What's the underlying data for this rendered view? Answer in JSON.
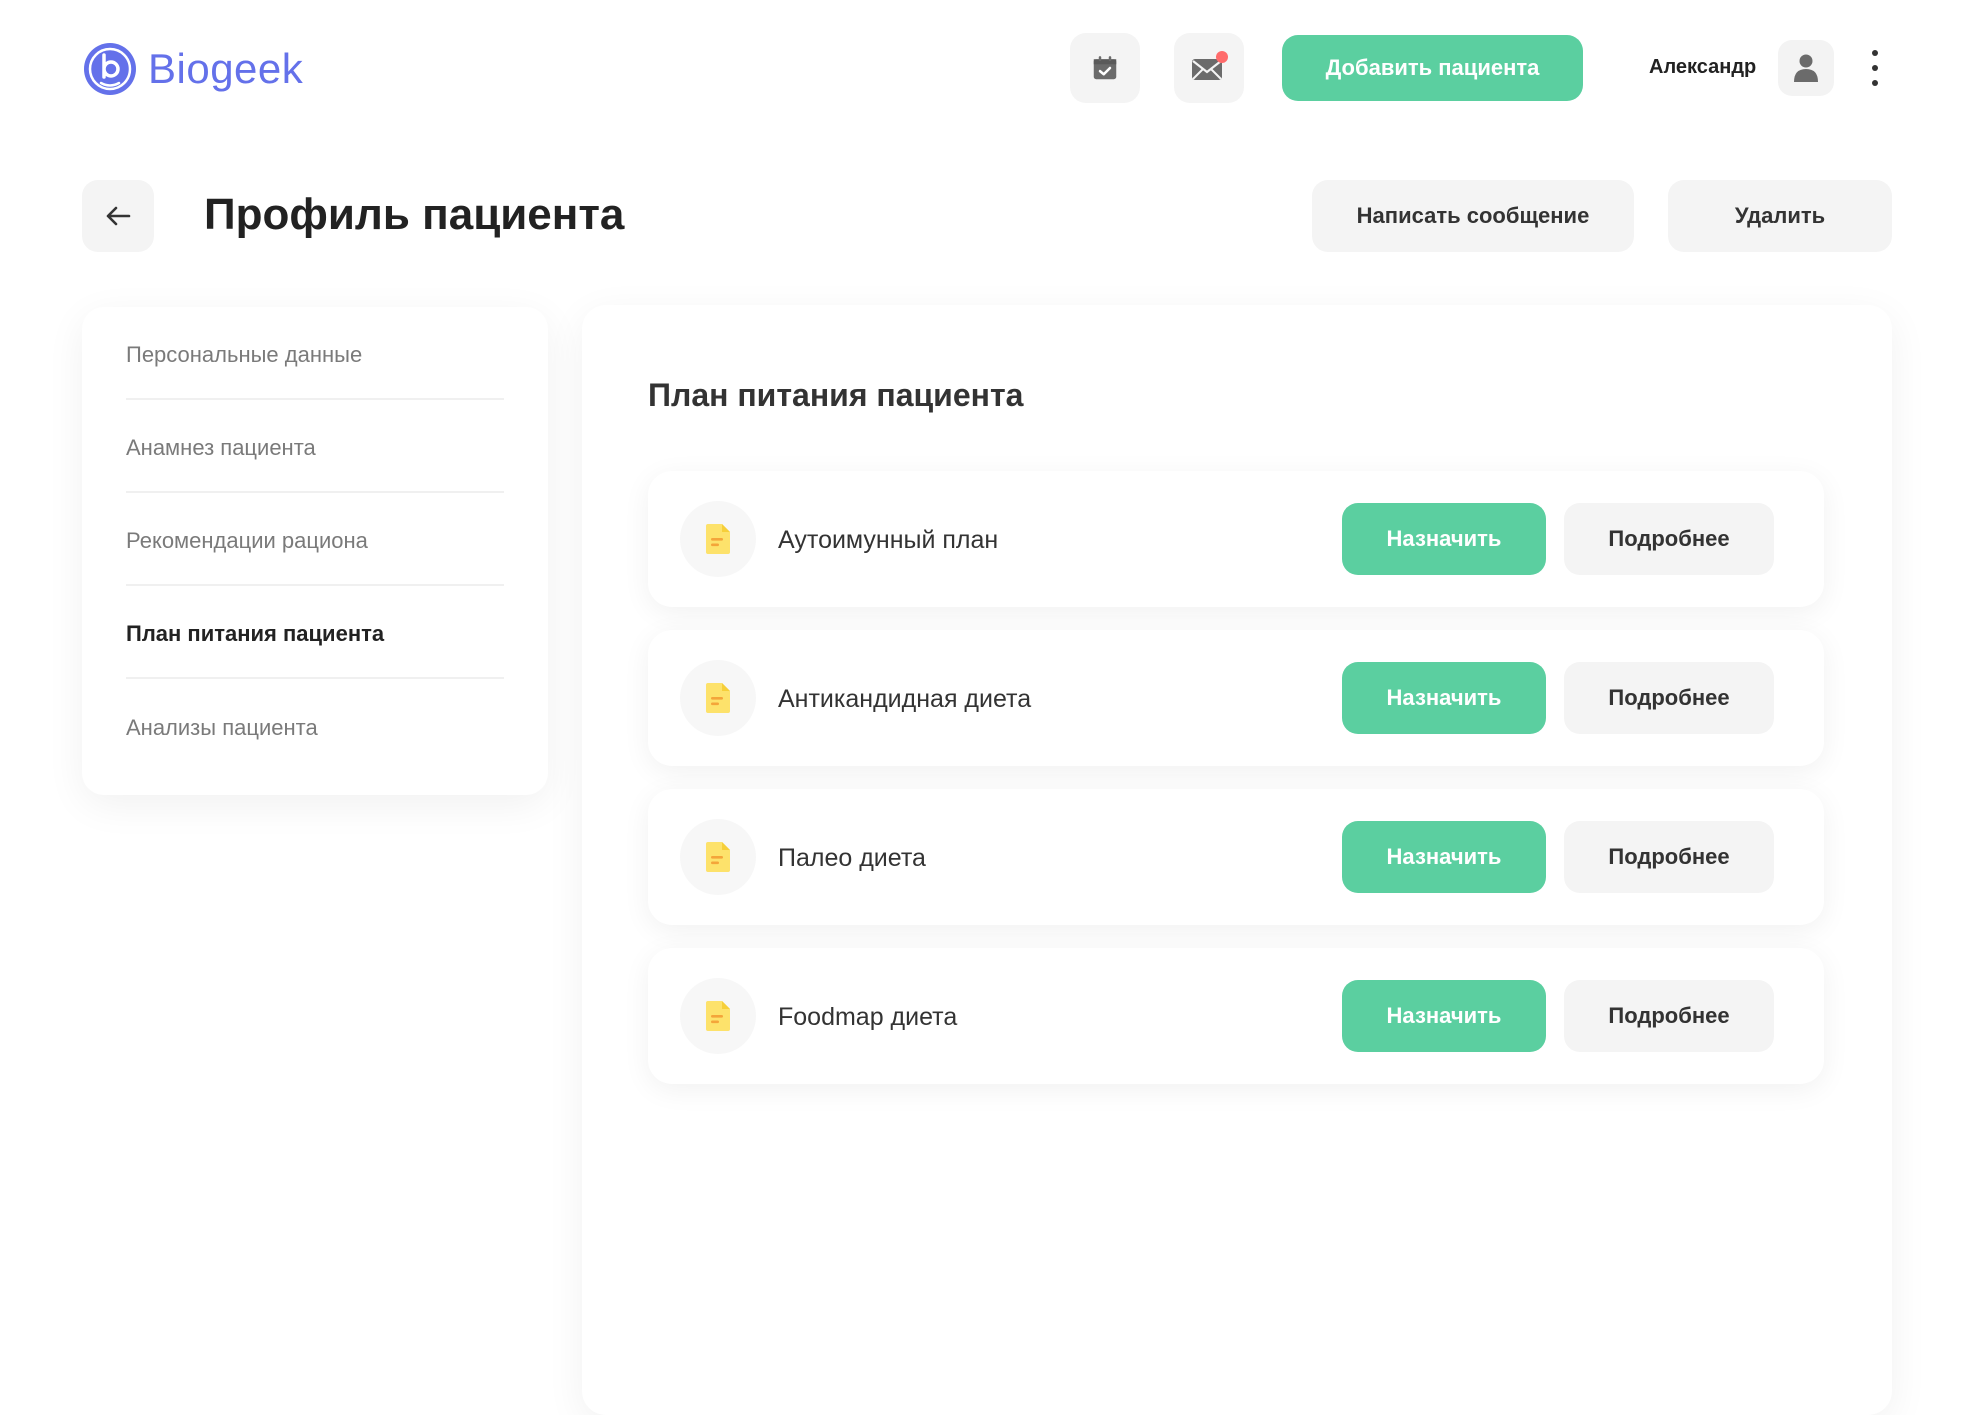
{
  "brand": {
    "name": "Biogeek",
    "color": "#6471ea"
  },
  "colors": {
    "accent": "#5bcfa0",
    "secondary_bg": "#f4f4f4",
    "notification": "#ff6b6b",
    "doc_icon": "#fde26b"
  },
  "header": {
    "calendar_icon": "calendar-check-icon",
    "mail_icon": "mail-icon",
    "add_patient_label": "Добавить пациента",
    "user_name": "Александр",
    "avatar_icon": "user-icon",
    "more_icon": "more-vertical-icon"
  },
  "page": {
    "back_icon": "arrow-left-icon",
    "title": "Профиль пациента",
    "message_label": "Написать сообщение",
    "delete_label": "Удалить"
  },
  "sidebar": {
    "items": [
      {
        "label": "Персональные данные",
        "active": false
      },
      {
        "label": "Анамнез пациента",
        "active": false
      },
      {
        "label": "Рекомендации рациона",
        "active": false
      },
      {
        "label": "План питания пациента",
        "active": true
      },
      {
        "label": "Анализы пациента",
        "active": false
      }
    ]
  },
  "main": {
    "section_title": "План питания пациента",
    "plans": [
      {
        "title": "Аутоимунный план",
        "assign_label": "Назначить",
        "details_label": "Подробнее",
        "icon": "document-icon"
      },
      {
        "title": "Антикандидная диета",
        "assign_label": "Назначить",
        "details_label": "Подробнее",
        "icon": "document-icon"
      },
      {
        "title": "Палео диета",
        "assign_label": "Назначить",
        "details_label": "Подробнее",
        "icon": "document-icon"
      },
      {
        "title": "Foodmap диета",
        "assign_label": "Назначить",
        "details_label": "Подробнее",
        "icon": "document-icon"
      }
    ]
  }
}
